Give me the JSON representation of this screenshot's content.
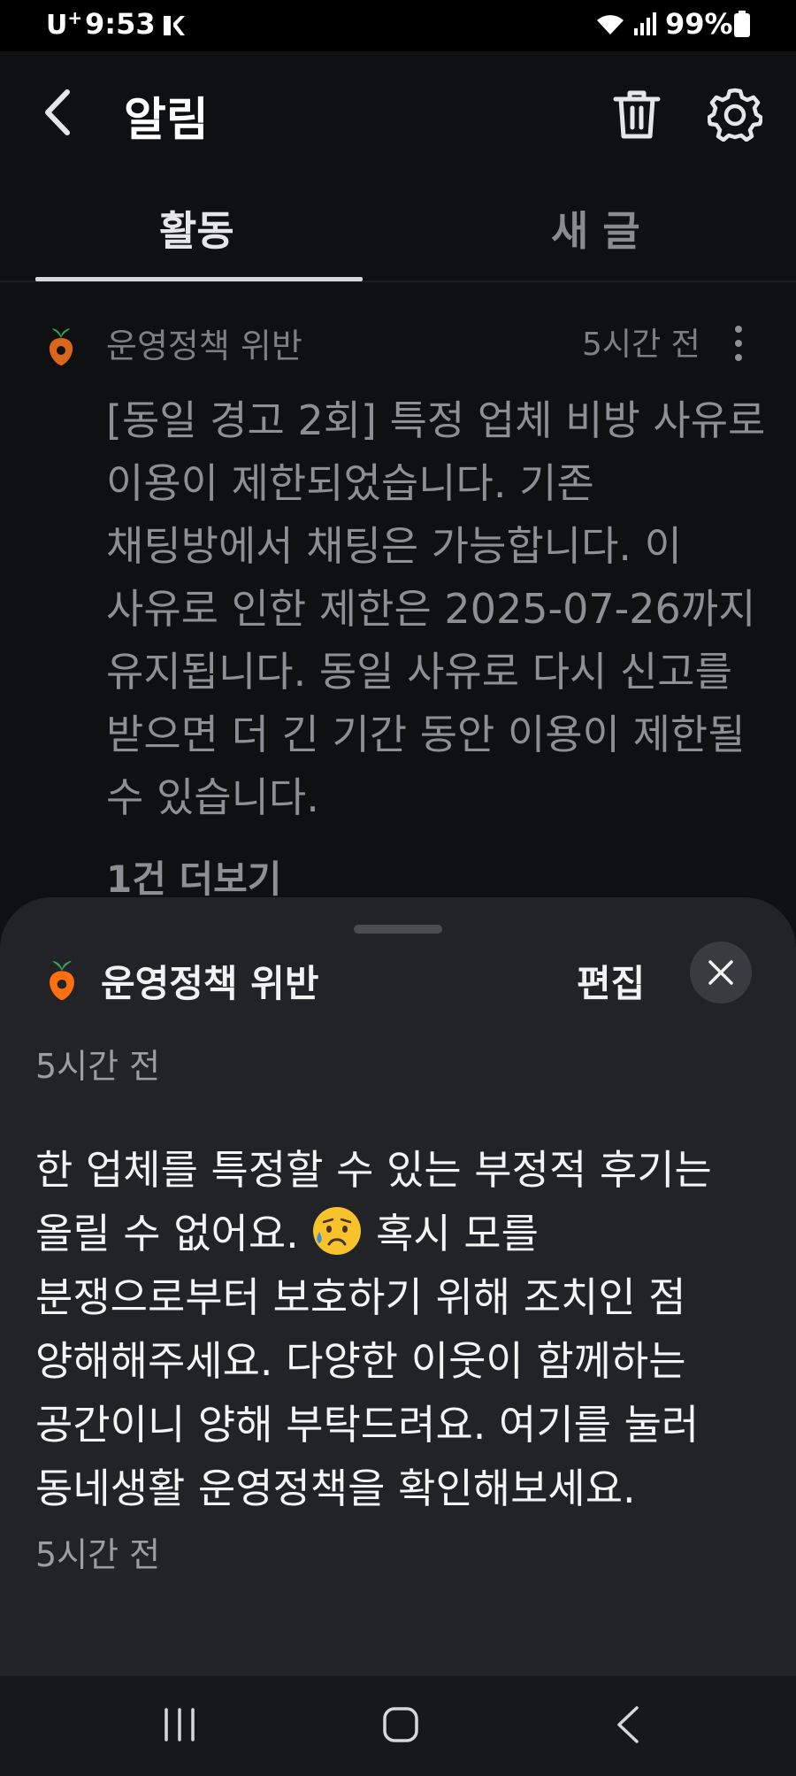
{
  "status_bar": {
    "carrier": "U",
    "carrier_suffix": "+",
    "time": "9:53",
    "battery_percent": "99%",
    "icons": [
      "app-notification-icon",
      "wifi-icon",
      "signal-icon",
      "battery-icon"
    ]
  },
  "header": {
    "title": "알림",
    "icons": [
      "back-arrow-icon",
      "trash-icon",
      "gear-icon"
    ]
  },
  "tabs": [
    {
      "label": "활동",
      "active": true
    },
    {
      "label": "새 글",
      "active": false
    }
  ],
  "background_notification": {
    "category": "운영정책 위반",
    "time": "5시간 전",
    "body": "[동일 경고 2회] 특정 업체 비방 사유로 이용이 제한되었습니다. 기존 채팅방에서 채팅은 가능합니다. 이 사유로 인한 제한은 2025-07-26까지 유지됩니다. 동일 사유로 다시 신고를 받으면 더 긴 기간 동안 이용이 제한될 수 있습니다.",
    "more_link": "1건 더보기"
  },
  "sheet": {
    "title": "운영정책 위반",
    "edit_label": "편집",
    "time_top": "5시간 전",
    "body_part1": "한 업체를 특정할 수 있는 부정적 후기는 올릴 수 없어요.",
    "emoji_icon": "sad-sweat-emoji",
    "body_part2": "혹시 모를 분쟁으로부터 보호하기 위해 조치인 점 양해해주세요. 다양한 이웃이 함께하는 공간이니 양해 부탁드려요. 여기를 눌러 동네생활 운영정책을 확인해보세요.",
    "time_bottom": "5시간 전"
  },
  "colors": {
    "background": "#0f1012",
    "sheet": "#212327",
    "carrot_orange": "#ff6f0f",
    "carrot_leaf": "#3aa35a"
  }
}
